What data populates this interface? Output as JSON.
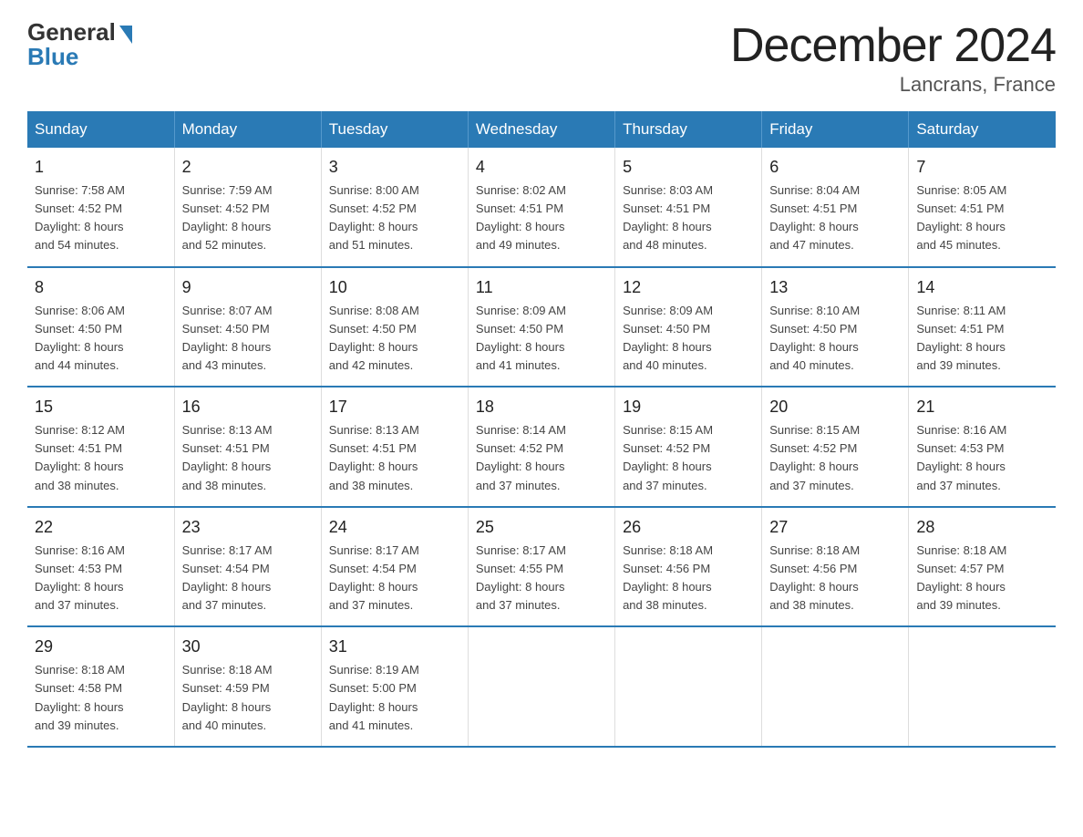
{
  "logo": {
    "general": "General",
    "blue": "Blue"
  },
  "title": "December 2024",
  "location": "Lancrans, France",
  "days_of_week": [
    "Sunday",
    "Monday",
    "Tuesday",
    "Wednesday",
    "Thursday",
    "Friday",
    "Saturday"
  ],
  "weeks": [
    [
      {
        "day": "1",
        "info": "Sunrise: 7:58 AM\nSunset: 4:52 PM\nDaylight: 8 hours\nand 54 minutes."
      },
      {
        "day": "2",
        "info": "Sunrise: 7:59 AM\nSunset: 4:52 PM\nDaylight: 8 hours\nand 52 minutes."
      },
      {
        "day": "3",
        "info": "Sunrise: 8:00 AM\nSunset: 4:52 PM\nDaylight: 8 hours\nand 51 minutes."
      },
      {
        "day": "4",
        "info": "Sunrise: 8:02 AM\nSunset: 4:51 PM\nDaylight: 8 hours\nand 49 minutes."
      },
      {
        "day": "5",
        "info": "Sunrise: 8:03 AM\nSunset: 4:51 PM\nDaylight: 8 hours\nand 48 minutes."
      },
      {
        "day": "6",
        "info": "Sunrise: 8:04 AM\nSunset: 4:51 PM\nDaylight: 8 hours\nand 47 minutes."
      },
      {
        "day": "7",
        "info": "Sunrise: 8:05 AM\nSunset: 4:51 PM\nDaylight: 8 hours\nand 45 minutes."
      }
    ],
    [
      {
        "day": "8",
        "info": "Sunrise: 8:06 AM\nSunset: 4:50 PM\nDaylight: 8 hours\nand 44 minutes."
      },
      {
        "day": "9",
        "info": "Sunrise: 8:07 AM\nSunset: 4:50 PM\nDaylight: 8 hours\nand 43 minutes."
      },
      {
        "day": "10",
        "info": "Sunrise: 8:08 AM\nSunset: 4:50 PM\nDaylight: 8 hours\nand 42 minutes."
      },
      {
        "day": "11",
        "info": "Sunrise: 8:09 AM\nSunset: 4:50 PM\nDaylight: 8 hours\nand 41 minutes."
      },
      {
        "day": "12",
        "info": "Sunrise: 8:09 AM\nSunset: 4:50 PM\nDaylight: 8 hours\nand 40 minutes."
      },
      {
        "day": "13",
        "info": "Sunrise: 8:10 AM\nSunset: 4:50 PM\nDaylight: 8 hours\nand 40 minutes."
      },
      {
        "day": "14",
        "info": "Sunrise: 8:11 AM\nSunset: 4:51 PM\nDaylight: 8 hours\nand 39 minutes."
      }
    ],
    [
      {
        "day": "15",
        "info": "Sunrise: 8:12 AM\nSunset: 4:51 PM\nDaylight: 8 hours\nand 38 minutes."
      },
      {
        "day": "16",
        "info": "Sunrise: 8:13 AM\nSunset: 4:51 PM\nDaylight: 8 hours\nand 38 minutes."
      },
      {
        "day": "17",
        "info": "Sunrise: 8:13 AM\nSunset: 4:51 PM\nDaylight: 8 hours\nand 38 minutes."
      },
      {
        "day": "18",
        "info": "Sunrise: 8:14 AM\nSunset: 4:52 PM\nDaylight: 8 hours\nand 37 minutes."
      },
      {
        "day": "19",
        "info": "Sunrise: 8:15 AM\nSunset: 4:52 PM\nDaylight: 8 hours\nand 37 minutes."
      },
      {
        "day": "20",
        "info": "Sunrise: 8:15 AM\nSunset: 4:52 PM\nDaylight: 8 hours\nand 37 minutes."
      },
      {
        "day": "21",
        "info": "Sunrise: 8:16 AM\nSunset: 4:53 PM\nDaylight: 8 hours\nand 37 minutes."
      }
    ],
    [
      {
        "day": "22",
        "info": "Sunrise: 8:16 AM\nSunset: 4:53 PM\nDaylight: 8 hours\nand 37 minutes."
      },
      {
        "day": "23",
        "info": "Sunrise: 8:17 AM\nSunset: 4:54 PM\nDaylight: 8 hours\nand 37 minutes."
      },
      {
        "day": "24",
        "info": "Sunrise: 8:17 AM\nSunset: 4:54 PM\nDaylight: 8 hours\nand 37 minutes."
      },
      {
        "day": "25",
        "info": "Sunrise: 8:17 AM\nSunset: 4:55 PM\nDaylight: 8 hours\nand 37 minutes."
      },
      {
        "day": "26",
        "info": "Sunrise: 8:18 AM\nSunset: 4:56 PM\nDaylight: 8 hours\nand 38 minutes."
      },
      {
        "day": "27",
        "info": "Sunrise: 8:18 AM\nSunset: 4:56 PM\nDaylight: 8 hours\nand 38 minutes."
      },
      {
        "day": "28",
        "info": "Sunrise: 8:18 AM\nSunset: 4:57 PM\nDaylight: 8 hours\nand 39 minutes."
      }
    ],
    [
      {
        "day": "29",
        "info": "Sunrise: 8:18 AM\nSunset: 4:58 PM\nDaylight: 8 hours\nand 39 minutes."
      },
      {
        "day": "30",
        "info": "Sunrise: 8:18 AM\nSunset: 4:59 PM\nDaylight: 8 hours\nand 40 minutes."
      },
      {
        "day": "31",
        "info": "Sunrise: 8:19 AM\nSunset: 5:00 PM\nDaylight: 8 hours\nand 41 minutes."
      },
      {
        "day": "",
        "info": ""
      },
      {
        "day": "",
        "info": ""
      },
      {
        "day": "",
        "info": ""
      },
      {
        "day": "",
        "info": ""
      }
    ]
  ]
}
